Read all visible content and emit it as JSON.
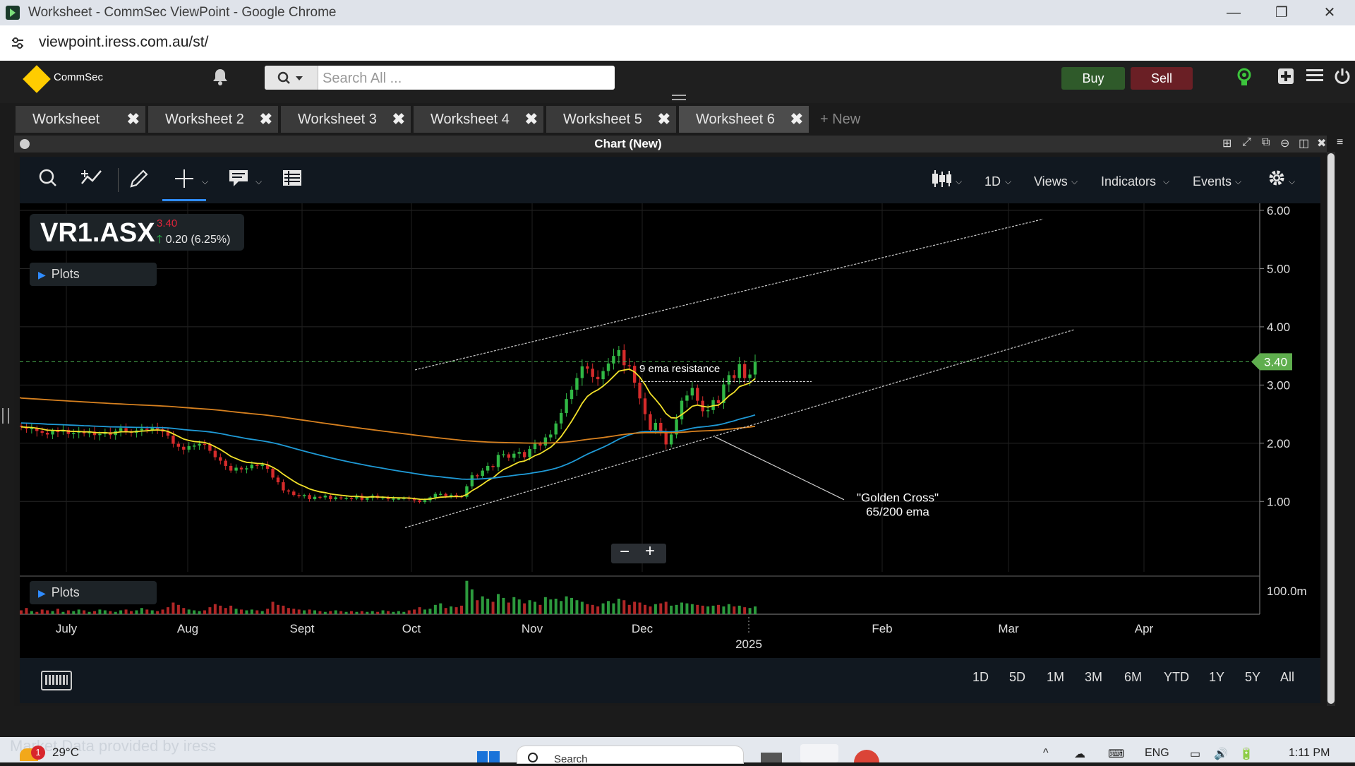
{
  "window": {
    "title": "Worksheet - CommSec ViewPoint - Google Chrome",
    "min": "—",
    "restore": "❐",
    "close": "✕"
  },
  "browser": {
    "url": "viewpoint.iress.com.au/st/"
  },
  "header": {
    "brand": "CommSec",
    "search_placeholder": "Search All ...",
    "buy": "Buy",
    "sell": "Sell"
  },
  "tabs": [
    "Worksheet",
    "Worksheet 2",
    "Worksheet 3",
    "Worksheet 4",
    "Worksheet 5",
    "Worksheet 6"
  ],
  "active_tab": 5,
  "new_tab": "+ New",
  "chart_window": {
    "title": "Chart (New)"
  },
  "toolbar": {
    "interval": "1D",
    "views": "Views",
    "indicators": "Indicators",
    "events": "Events"
  },
  "quote": {
    "symbol": "VR1.ASX",
    "price": "3.40",
    "change": "0.20 (6.25%)"
  },
  "plots_label": "Plots",
  "annotations": {
    "resistance": "9 ema resistance",
    "golden_cross_1": "\"Golden Cross\"",
    "golden_cross_2": "65/200 ema"
  },
  "chart_data": {
    "type": "candlestick",
    "x_axis_labels": [
      "July",
      "Aug",
      "Sept",
      "Oct",
      "Nov",
      "Dec",
      "2025",
      "Feb",
      "Mar",
      "Apr"
    ],
    "y_axis_labels": [
      "6.00",
      "5.00",
      "4.00",
      "3.00",
      "2.00",
      "1.00"
    ],
    "volume_axis_label": "100.0m",
    "ylim": [
      0.3,
      6.0
    ],
    "last_price": 3.4,
    "last_price_label": "3.40",
    "close": [
      2.28,
      2.25,
      2.26,
      2.21,
      2.18,
      2.15,
      2.21,
      2.2,
      2.23,
      2.16,
      2.18,
      2.2,
      2.17,
      2.2,
      2.14,
      2.16,
      2.19,
      2.14,
      2.21,
      2.26,
      2.2,
      2.18,
      2.22,
      2.25,
      2.23,
      2.27,
      2.24,
      2.2,
      2.13,
      1.99,
      1.94,
      1.89,
      1.95,
      1.96,
      1.99,
      1.98,
      1.87,
      1.76,
      1.7,
      1.61,
      1.53,
      1.58,
      1.55,
      1.57,
      1.63,
      1.61,
      1.63,
      1.56,
      1.41,
      1.33,
      1.19,
      1.17,
      1.11,
      1.09,
      1.11,
      1.04,
      1.08,
      1.07,
      1.1,
      1.04,
      1.07,
      1.06,
      1.06,
      1.05,
      1.1,
      1.03,
      1.06,
      1.1,
      1.06,
      1.07,
      1.04,
      1.05,
      1.05,
      1.06,
      1.05,
      1.02,
      0.99,
      1.02,
      1.07,
      1.13,
      1.13,
      1.09,
      1.11,
      1.09,
      1.08,
      1.26,
      1.45,
      1.44,
      1.53,
      1.61,
      1.59,
      1.8,
      1.81,
      1.75,
      1.82,
      1.85,
      1.76,
      1.9,
      1.99,
      1.96,
      2.1,
      2.15,
      2.34,
      2.52,
      2.76,
      2.92,
      3.12,
      3.32,
      3.28,
      3.14,
      3.1,
      3.24,
      3.37,
      3.5,
      3.6,
      3.34,
      3.33,
      3.04,
      2.77,
      2.5,
      2.23,
      2.35,
      2.21,
      1.98,
      2.15,
      2.41,
      2.73,
      2.82,
      2.95,
      2.73,
      2.55,
      2.57,
      2.74,
      2.69,
      3.01,
      3.17,
      3.12,
      3.36,
      3.12,
      3.18,
      3.4
    ],
    "volume": [
      0.5,
      0.8,
      0.4,
      0.3,
      0.6,
      0.5,
      0.4,
      0.7,
      0.3,
      0.5,
      0.4,
      0.6,
      0.5,
      0.3,
      0.4,
      0.6,
      0.5,
      0.4,
      0.3,
      0.5,
      0.6,
      0.4,
      0.5,
      0.8,
      0.6,
      0.5,
      0.4,
      0.6,
      0.9,
      1.5,
      1.2,
      0.8,
      0.6,
      0.5,
      0.4,
      0.5,
      0.9,
      1.3,
      1.1,
      0.8,
      1.1,
      0.7,
      0.6,
      0.5,
      0.6,
      0.5,
      0.4,
      0.7,
      1.6,
      1.2,
      1.1,
      0.8,
      0.7,
      0.6,
      0.5,
      0.6,
      0.5,
      0.4,
      0.3,
      0.4,
      0.5,
      0.4,
      0.3,
      0.4,
      0.3,
      0.4,
      0.3,
      0.4,
      0.3,
      0.5,
      0.4,
      0.3,
      0.4,
      0.3,
      0.5,
      0.6,
      0.9,
      0.6,
      0.7,
      1.2,
      1.4,
      0.8,
      1.0,
      0.9,
      1.1,
      4.3,
      3.2,
      1.8,
      2.3,
      2.0,
      1.6,
      2.6,
      2.1,
      1.5,
      2.2,
      1.9,
      1.4,
      1.8,
      1.6,
      1.2,
      2.2,
      1.9,
      2.0,
      1.7,
      2.3,
      2.1,
      1.8,
      1.6,
      1.3,
      1.2,
      1.0,
      1.4,
      1.7,
      1.4,
      2.0,
      1.8,
      1.2,
      1.6,
      1.5,
      1.2,
      1.0,
      1.3,
      1.4,
      1.6,
      1.1,
      1.2,
      1.5,
      1.4,
      1.3,
      1.2,
      1.1,
      1.0,
      1.1,
      1.2,
      1.0,
      1.3,
      1.0,
      1.1,
      0.9,
      0.8,
      1.0
    ]
  },
  "ranges": [
    "1D",
    "5D",
    "1M",
    "3M",
    "6M",
    "YTD",
    "1Y",
    "5Y",
    "All"
  ],
  "taskbar": {
    "weather": "29°C",
    "badge": "1",
    "search": "Search",
    "language": "ENG",
    "time": "1:11 PM"
  },
  "footer_faint": "Market Data provided by iress"
}
